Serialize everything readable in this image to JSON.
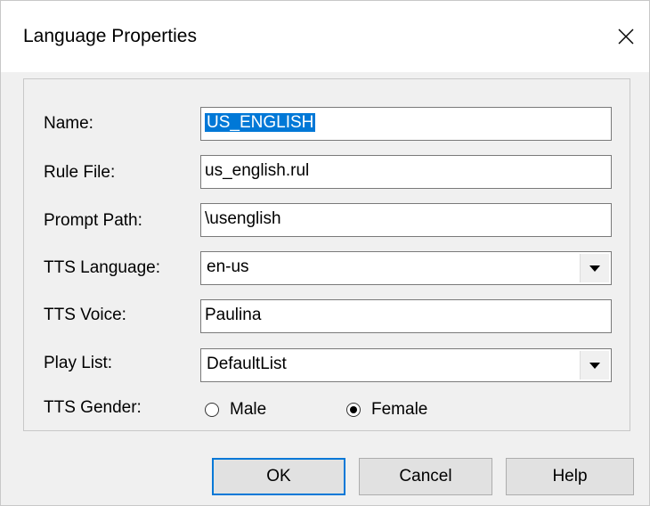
{
  "window": {
    "title": "Language Properties"
  },
  "form": {
    "name_label": "Name:",
    "name_value": "US_ENGLISH",
    "rule_file_label": "Rule File:",
    "rule_file_value": "us_english.rul",
    "prompt_path_label": "Prompt Path:",
    "prompt_path_value": "\\usenglish",
    "tts_language_label": "TTS Language:",
    "tts_language_value": "en-us",
    "tts_voice_label": "TTS Voice:",
    "tts_voice_value": "Paulina",
    "play_list_label": "Play List:",
    "play_list_value": "DefaultList",
    "tts_gender_label": "TTS Gender:",
    "gender_options": [
      "Male",
      "Female"
    ],
    "gender_selected": "Female"
  },
  "buttons": {
    "ok": "OK",
    "cancel": "Cancel",
    "help": "Help"
  },
  "icons": {
    "close": "close-icon",
    "dropdown": "chevron-down-icon"
  },
  "colors": {
    "selection": "#0078d7",
    "default_button_border": "#0078d7"
  }
}
